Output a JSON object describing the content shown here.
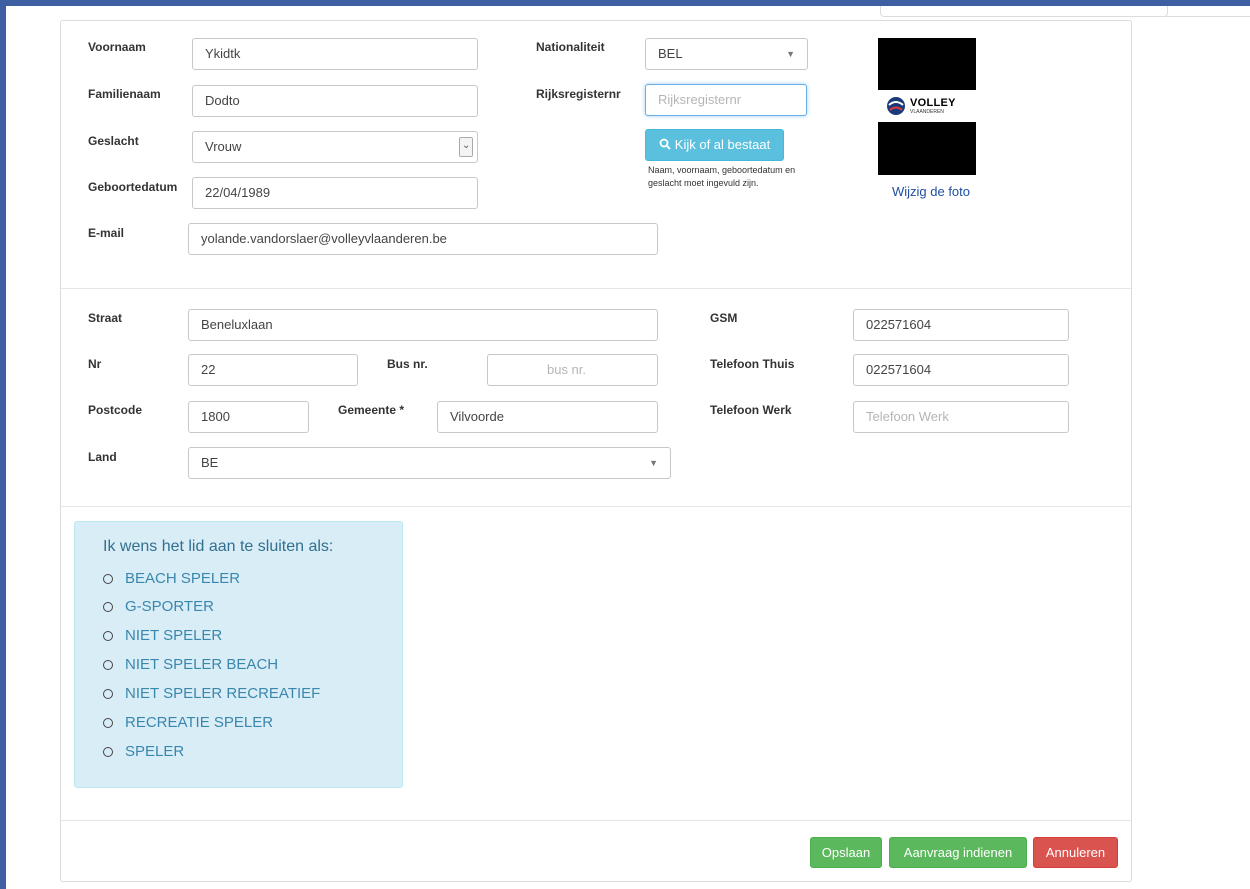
{
  "personal": {
    "first_name_label": "Voornaam",
    "first_name_value": "Ykidtk",
    "last_name_label": "Familienaam",
    "last_name_value": "Dodto",
    "gender_label": "Geslacht",
    "gender_value": "Vrouw",
    "birthdate_label": "Geboortedatum",
    "birthdate_value": "22/04/1989",
    "email_label": "E-mail",
    "email_value": "yolande.vandorslaer@volleyvlaanderen.be",
    "nationality_label": "Nationaliteit",
    "nationality_value": "BEL",
    "register_label": "Rijksregisternr",
    "register_placeholder": "Rijksregisternr",
    "check_button": "Kijk of al bestaat",
    "check_hint": "Naam, voornaam, geboortedatum en geslacht moet ingevuld zijn."
  },
  "photo": {
    "logo_text": "VOLLEY",
    "logo_sub": "VLAANDEREN",
    "change_link": "Wijzig de foto"
  },
  "address": {
    "street_label": "Straat",
    "street_value": "Beneluxlaan",
    "nr_label": "Nr",
    "nr_value": "22",
    "bus_label": "Bus nr.",
    "bus_placeholder": "bus nr.",
    "postcode_label": "Postcode",
    "postcode_value": "1800",
    "city_label": "Gemeente *",
    "city_value": "Vilvoorde",
    "country_label": "Land",
    "country_value": "BE",
    "gsm_label": "GSM",
    "gsm_value": "022571604",
    "phone_home_label": "Telefoon Thuis",
    "phone_home_value": "022571604",
    "phone_work_label": "Telefoon Werk",
    "phone_work_placeholder": "Telefoon Werk"
  },
  "membership": {
    "title": "Ik wens het lid aan te sluiten als:",
    "options": [
      "BEACH SPELER",
      "G-SPORTER",
      "NIET SPELER",
      "NIET SPELER BEACH",
      "NIET SPELER RECREATIEF",
      "RECREATIE SPELER",
      "SPELER"
    ]
  },
  "actions": {
    "save": "Opslaan",
    "submit": "Aanvraag indienen",
    "cancel": "Annuleren"
  },
  "colors": {
    "info": "#5bc0de",
    "success": "#5cb85c",
    "danger": "#d9534f",
    "well": "#d9edf7"
  }
}
